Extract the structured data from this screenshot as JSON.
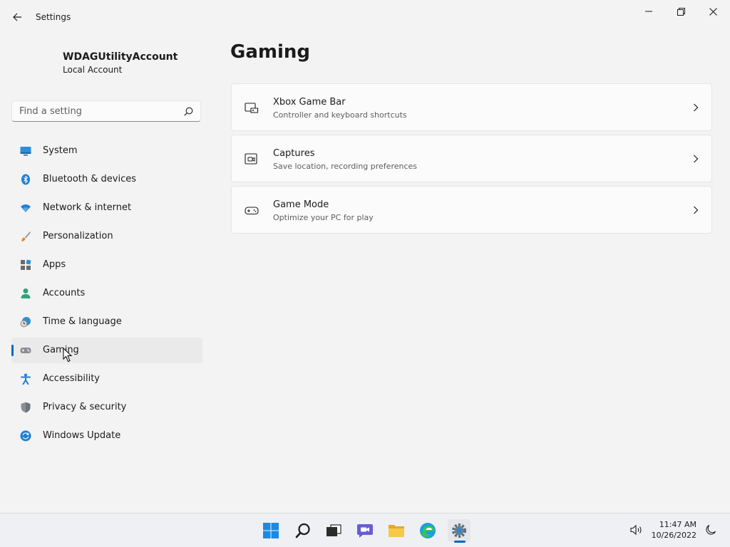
{
  "window": {
    "app_title": "Settings"
  },
  "profile": {
    "name": "WDAGUtilityAccount",
    "type": "Local Account"
  },
  "search": {
    "placeholder": "Find a setting",
    "value": ""
  },
  "sidebar": {
    "selected_index": 7,
    "items": [
      {
        "label": "System",
        "icon": "monitor-icon"
      },
      {
        "label": "Bluetooth & devices",
        "icon": "bluetooth-icon"
      },
      {
        "label": "Network & internet",
        "icon": "wifi-icon"
      },
      {
        "label": "Personalization",
        "icon": "brush-icon"
      },
      {
        "label": "Apps",
        "icon": "apps-icon"
      },
      {
        "label": "Accounts",
        "icon": "person-icon"
      },
      {
        "label": "Time & language",
        "icon": "clock-globe-icon"
      },
      {
        "label": "Gaming",
        "icon": "gamepad-icon"
      },
      {
        "label": "Accessibility",
        "icon": "accessibility-icon"
      },
      {
        "label": "Privacy & security",
        "icon": "shield-icon"
      },
      {
        "label": "Windows Update",
        "icon": "update-icon"
      }
    ]
  },
  "main": {
    "title": "Gaming",
    "cards": [
      {
        "title": "Xbox Game Bar",
        "subtitle": "Controller and keyboard shortcuts",
        "icon": "game-bar-icon"
      },
      {
        "title": "Captures",
        "subtitle": "Save location, recording preferences",
        "icon": "capture-icon"
      },
      {
        "title": "Game Mode",
        "subtitle": "Optimize your PC for play",
        "icon": "gamepad-icon"
      }
    ]
  },
  "taskbar": {
    "apps": [
      "start-icon",
      "search-icon",
      "task-view-icon",
      "chat-icon",
      "file-explorer-icon",
      "edge-icon",
      "settings-icon"
    ],
    "active_app": "settings-icon"
  },
  "tray": {
    "time": "11:47 AM",
    "date": "10/26/2022"
  },
  "colors": {
    "accent": "#0067c0",
    "background": "#f3f3f3",
    "card": "#fbfbfb"
  }
}
